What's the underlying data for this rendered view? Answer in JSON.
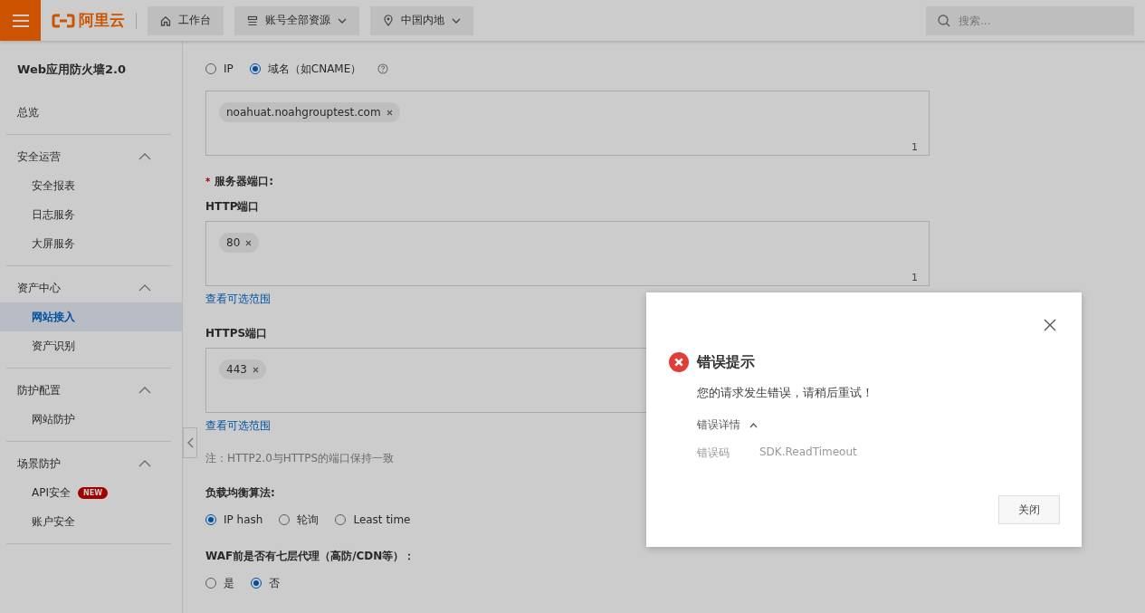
{
  "header": {
    "logo": "阿里云",
    "nav": [
      {
        "label": "工作台",
        "dropdown": false
      },
      {
        "label": "账号全部资源",
        "dropdown": true
      },
      {
        "label": "中国内地",
        "dropdown": true
      }
    ],
    "search": {
      "placeholder": "搜索..."
    }
  },
  "sidebar": {
    "title": "Web应用防火墙2.0",
    "groups": [
      {
        "label": "总览"
      },
      {
        "label": "安全运营",
        "expanded": true,
        "items": [
          {
            "label": "安全报表",
            "selected": false
          },
          {
            "label": "日志服务",
            "selected": false
          },
          {
            "label": "大屏服务",
            "selected": false
          }
        ]
      },
      {
        "label": "资产中心",
        "expanded": true,
        "items": [
          {
            "label": "网站接入",
            "selected": true
          },
          {
            "label": "资产识别",
            "selected": false
          }
        ]
      },
      {
        "label": "防护配置",
        "expanded": true,
        "items": [
          {
            "label": "网站防护",
            "selected": false
          }
        ]
      },
      {
        "label": "场景防护",
        "expanded": true,
        "items": [
          {
            "label": "API安全",
            "selected": false,
            "badge": "NEW"
          },
          {
            "label": "账户安全",
            "selected": false
          }
        ]
      }
    ]
  },
  "form": [
    {
      "kind": "radios",
      "help": true,
      "options": [
        {
          "label": "IP",
          "selected": false
        },
        {
          "label": "域名（如CNAME）",
          "selected": true
        }
      ]
    },
    {
      "kind": "tags",
      "tags": [
        "noahuat.noahgrouptest.com"
      ],
      "count": "1"
    },
    {
      "kind": "label",
      "marker": "*",
      "text": "服务器端口:"
    },
    {
      "kind": "sublabel",
      "text": "HTTP端口"
    },
    {
      "kind": "tags",
      "tags": [
        "80"
      ],
      "count": "1"
    },
    {
      "kind": "link",
      "text": "查看可选范围"
    },
    {
      "kind": "sublabel",
      "text": "HTTPS端口"
    },
    {
      "kind": "tags",
      "tags": [
        "443"
      ]
    },
    {
      "kind": "link",
      "text": "查看可选范围"
    },
    {
      "kind": "note",
      "text": "注：HTTP2.0与HTTPS的端口保持一致"
    },
    {
      "kind": "label",
      "text": "负载均衡算法:"
    },
    {
      "kind": "radios",
      "options": [
        {
          "label": "IP hash",
          "selected": true
        },
        {
          "label": "轮询",
          "selected": false
        },
        {
          "label": "Least time",
          "selected": false
        }
      ]
    },
    {
      "kind": "label",
      "text": "WAF前是否有七层代理（高防/CDN等）："
    },
    {
      "kind": "radios",
      "options": [
        {
          "label": "是",
          "selected": false
        },
        {
          "label": "否",
          "selected": true
        }
      ]
    }
  ],
  "dialog": {
    "title": "错误提示",
    "message": "您的请求发生错误，请稍后重试！",
    "details_label": "错误详情",
    "details_expanded": true,
    "details": [
      {
        "key": "错误码",
        "value": "SDK.ReadTimeout"
      }
    ],
    "button": "关闭"
  }
}
